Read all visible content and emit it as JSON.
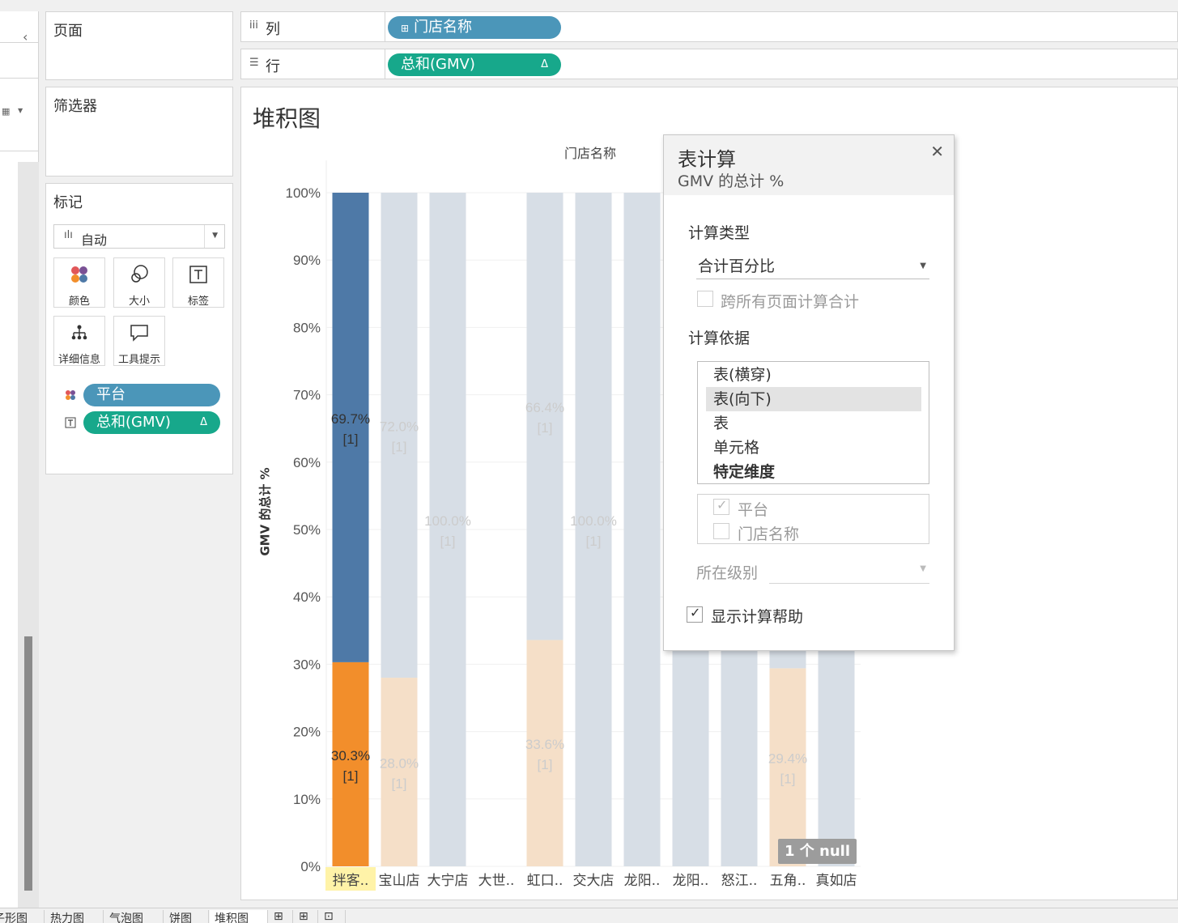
{
  "left_panel": {
    "collapse_icon": "chevron-left-icon",
    "view_icon": "grid-icon"
  },
  "shelves": {
    "pages_title": "页面",
    "filters_title": "筛选器",
    "marks_title": "标记",
    "mark_type": "自动",
    "mark_buttons": [
      {
        "label": "颜色",
        "icon": "color-icon"
      },
      {
        "label": "大小",
        "icon": "size-icon"
      },
      {
        "label": "标签",
        "icon": "label-icon"
      },
      {
        "label": "详细信息",
        "icon": "detail-icon"
      },
      {
        "label": "工具提示",
        "icon": "tooltip-icon"
      }
    ],
    "mark_pills": [
      {
        "label": "平台",
        "color": "#4b96b9",
        "icon": "color-icon"
      },
      {
        "label": "总和(GMV)",
        "color": "#17a88b",
        "icon": "label-icon",
        "delta": "Δ"
      }
    ]
  },
  "columns_shelf": {
    "label": "列",
    "pill": "门店名称",
    "pill_prefix": "⊞"
  },
  "rows_shelf": {
    "label": "行",
    "pill": "总和(GMV)",
    "delta": "Δ"
  },
  "sheet": {
    "title": "堆积图",
    "null_badge": "1 个 null"
  },
  "chart_data": {
    "type": "bar",
    "stacked": true,
    "title": "堆积图",
    "column_header": "门店名称",
    "ylabel": "GMV 的总计 %",
    "ylim": [
      0,
      100
    ],
    "yticks": [
      "0%",
      "10%",
      "20%",
      "30%",
      "40%",
      "50%",
      "60%",
      "70%",
      "80%",
      "90%",
      "100%"
    ],
    "categories": [
      "拌客..",
      "宝山店",
      "大宁店",
      "大世..",
      "虹口..",
      "交大店",
      "龙阳..",
      "龙阳..",
      "怒江..",
      "五角..",
      "真如店"
    ],
    "highlighted_index": 0,
    "series": [
      {
        "color": "#f28e2b",
        "faded_color": "#f5dfc8",
        "values": [
          30.3,
          28.0,
          0,
          0,
          33.6,
          0,
          null,
          null,
          null,
          29.4,
          null
        ]
      },
      {
        "color": "#4e79a7",
        "faded_color": "#d7dee6",
        "values": [
          69.7,
          72.0,
          100.0,
          0,
          66.4,
          100.0,
          null,
          null,
          null,
          70.6,
          null
        ]
      }
    ],
    "label_suffix": "[1]",
    "data_labels": [
      {
        "category_index": 0,
        "series": 1,
        "text": "69.7%"
      },
      {
        "category_index": 0,
        "series": 0,
        "text": "30.3%"
      },
      {
        "category_index": 1,
        "series": 1,
        "text": "72.0%"
      },
      {
        "category_index": 1,
        "series": 0,
        "text": "28.0%"
      },
      {
        "category_index": 2,
        "series": 1,
        "text": "100.0%"
      },
      {
        "category_index": 4,
        "series": 1,
        "text": "66.4%"
      },
      {
        "category_index": 4,
        "series": 0,
        "text": "33.6%"
      },
      {
        "category_index": 5,
        "series": 1,
        "text": "100.0%"
      },
      {
        "category_index": 9,
        "series": 0,
        "text": "29.4%"
      }
    ]
  },
  "table_calc_popup": {
    "title": "表计算",
    "subtitle": "GMV 的总计 %",
    "calc_type_heading": "计算类型",
    "calc_type_value": "合计百分比",
    "across_pages_label": "跨所有页面计算合计",
    "compute_using_heading": "计算依据",
    "compute_options": [
      "表(横穿)",
      "表(向下)",
      "表",
      "单元格",
      "特定维度"
    ],
    "selected_option": "表(向下)",
    "dimensions": [
      {
        "label": "平台",
        "checked": true
      },
      {
        "label": "门店名称",
        "checked": false
      }
    ],
    "level_label": "所在级别",
    "show_help_label": "显示计算帮助",
    "show_help_checked": true
  },
  "tabs": [
    "子形图",
    "热力图",
    "气泡图",
    "饼图",
    "堆积图"
  ],
  "active_tab": "堆积图"
}
